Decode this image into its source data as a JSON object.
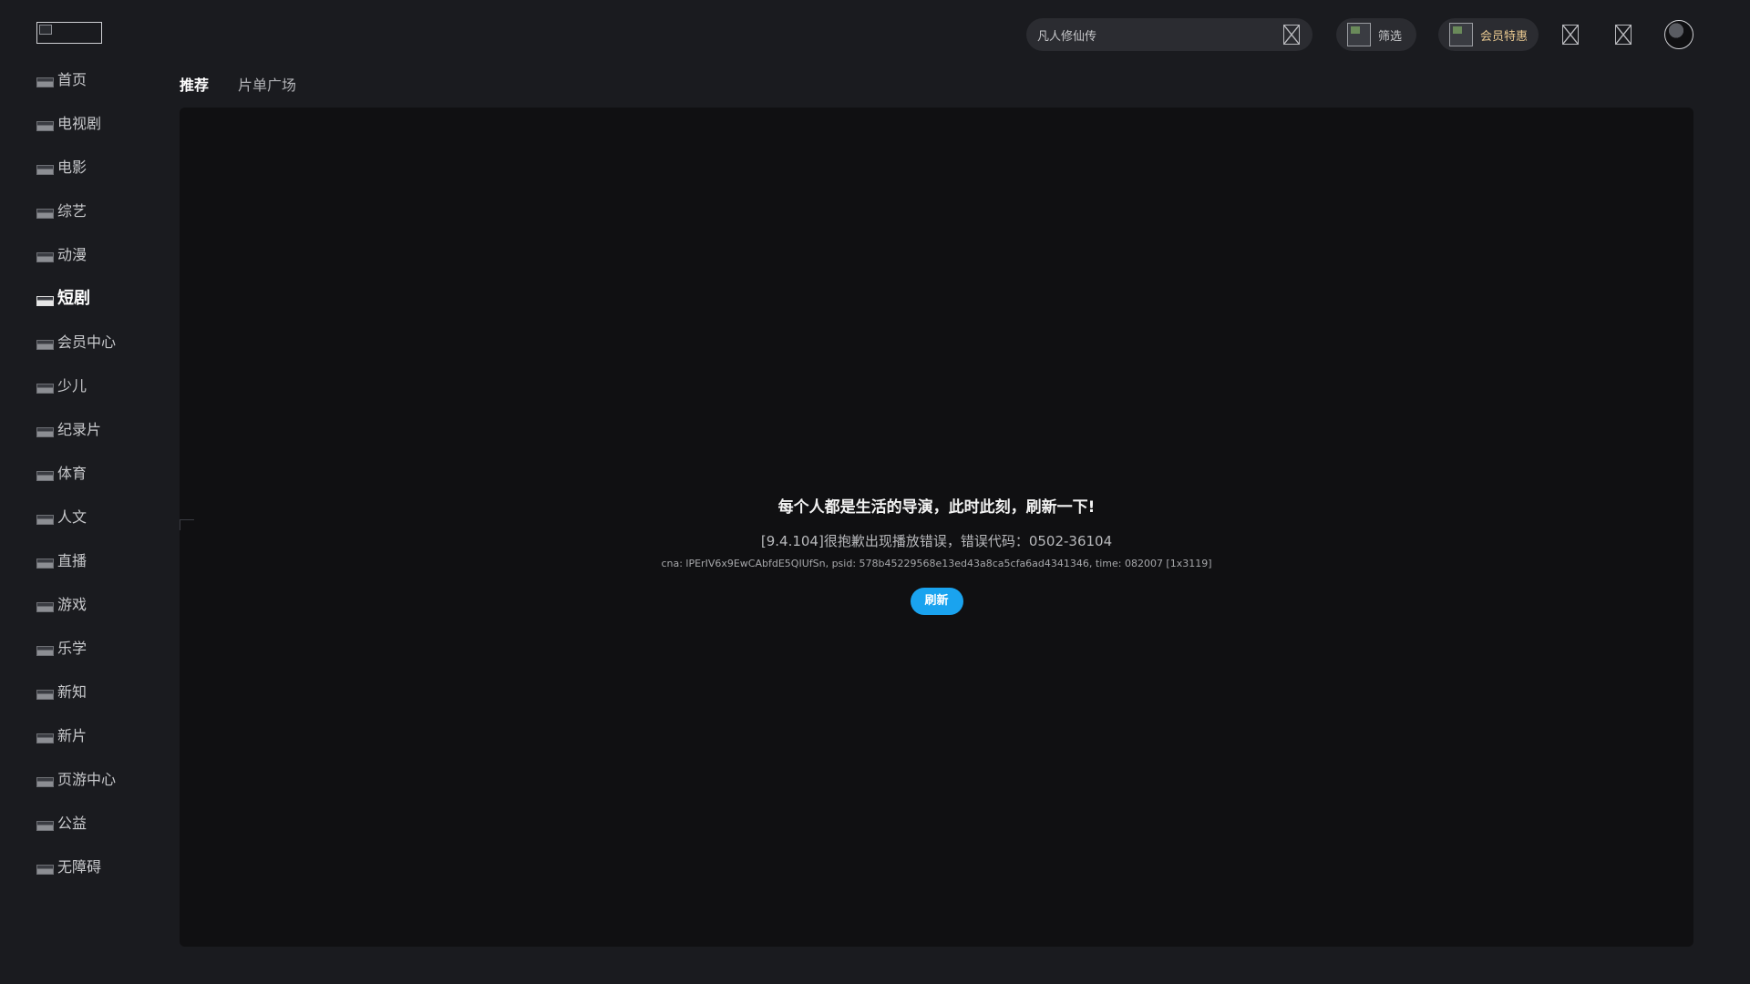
{
  "sidebar": {
    "items": [
      {
        "label": "首页"
      },
      {
        "label": "电视剧"
      },
      {
        "label": "电影"
      },
      {
        "label": "综艺"
      },
      {
        "label": "动漫"
      },
      {
        "label": "短剧"
      },
      {
        "label": "会员中心"
      },
      {
        "label": "少儿"
      },
      {
        "label": "纪录片"
      },
      {
        "label": "体育"
      },
      {
        "label": "人文"
      },
      {
        "label": "直播"
      },
      {
        "label": "游戏"
      },
      {
        "label": "乐学"
      },
      {
        "label": "新知"
      },
      {
        "label": "新片"
      },
      {
        "label": "页游中心"
      },
      {
        "label": "公益"
      },
      {
        "label": "无障碍"
      }
    ],
    "active_item": "短剧"
  },
  "header": {
    "search": {
      "value": "凡人修仙传",
      "placeholder": "凡人修仙传"
    },
    "filter_label": "筛选",
    "vip_label": "会员特惠"
  },
  "tabs": [
    {
      "label": "推荐",
      "active": true
    },
    {
      "label": "片单广场",
      "active": false
    }
  ],
  "player": {
    "error_title": "每个人都是生活的导演，此时此刻，刷新一下!",
    "error_message": "[9.4.104]很抱歉出现播放错误，错误代码：0502-36104",
    "error_detail": "cna: lPErIV6x9EwCAbfdE5QIUfSn, psid: 578b45229568e13ed43a8ca5cfa6ad4341346, time: 082007 [1x3119]",
    "refresh_label": "刷新"
  },
  "colors": {
    "background": "#1a1b1f",
    "player_background": "#101012",
    "accent": "#1aa3ef",
    "vip_text": "#e8c890"
  }
}
